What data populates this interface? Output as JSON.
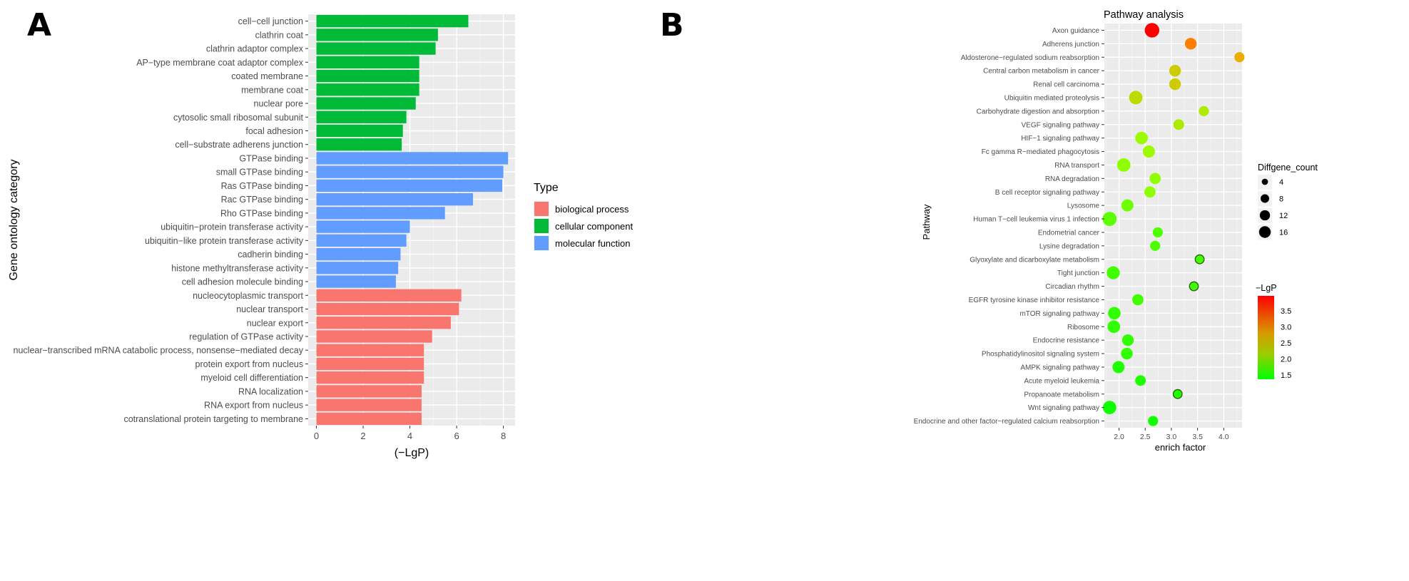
{
  "panels": {
    "a_label": "A",
    "b_label": "B"
  },
  "chart_data": [
    {
      "type": "bar",
      "orientation": "horizontal",
      "title": "",
      "xlabel": "(−LgP)",
      "ylabel": "Gene ontology category",
      "xlim": [
        0,
        8.5
      ],
      "xticks": [
        0,
        2,
        4,
        6,
        8
      ],
      "grid": true,
      "legend": {
        "title": "Type",
        "placement": "right",
        "entries": [
          {
            "label": "biological process",
            "color": "#F8766D"
          },
          {
            "label": "cellular component",
            "color": "#00BA38"
          },
          {
            "label": "molecular function",
            "color": "#619CFF"
          }
        ]
      },
      "categories": [
        "cell−cell junction",
        "clathrin coat",
        "clathrin adaptor complex",
        "AP−type membrane coat adaptor complex",
        "coated membrane",
        "membrane coat",
        "nuclear pore",
        "cytosolic small ribosomal subunit",
        "focal adhesion",
        "cell−substrate adherens junction",
        "GTPase binding",
        "small GTPase binding",
        "Ras GTPase binding",
        "Rac GTPase binding",
        "Rho GTPase binding",
        "ubiquitin−protein transferase activity",
        "ubiquitin−like protein transferase activity",
        "cadherin binding",
        "histone methyltransferase activity",
        "cell adhesion molecule binding",
        "nucleocytoplasmic transport",
        "nuclear transport",
        "nuclear export",
        "regulation of GTPase activity",
        "nuclear−transcribed mRNA catabolic process, nonsense−mediated decay",
        "protein export from nucleus",
        "myeloid cell differentiation",
        "RNA localization",
        "RNA export from nucleus",
        "cotranslational protein targeting to membrane"
      ],
      "values": [
        6.5,
        5.2,
        5.1,
        4.4,
        4.4,
        4.4,
        4.25,
        3.85,
        3.7,
        3.65,
        8.2,
        8.0,
        7.95,
        6.7,
        5.5,
        4.0,
        3.85,
        3.6,
        3.5,
        3.4,
        6.2,
        6.1,
        5.75,
        4.95,
        4.6,
        4.6,
        4.6,
        4.5,
        4.5,
        4.5
      ],
      "types": [
        "cellular component",
        "cellular component",
        "cellular component",
        "cellular component",
        "cellular component",
        "cellular component",
        "cellular component",
        "cellular component",
        "cellular component",
        "cellular component",
        "molecular function",
        "molecular function",
        "molecular function",
        "molecular function",
        "molecular function",
        "molecular function",
        "molecular function",
        "molecular function",
        "molecular function",
        "molecular function",
        "biological process",
        "biological process",
        "biological process",
        "biological process",
        "biological process",
        "biological process",
        "biological process",
        "biological process",
        "biological process",
        "biological process"
      ]
    },
    {
      "type": "scatter",
      "title": "Pathway analysis",
      "xlabel": "enrich factor",
      "ylabel": "Pathway",
      "xlim": [
        1.72,
        4.35
      ],
      "xticks": [
        "2.0",
        "2.5",
        "3.0",
        "3.5",
        "4.0"
      ],
      "grid": true,
      "size_legend": {
        "title": "Diffgene_count",
        "placement": "right",
        "values": [
          4,
          8,
          12,
          16
        ]
      },
      "color_legend": {
        "title": "−LgP",
        "placement": "right",
        "ticks": [
          "3.5",
          "3.0",
          "2.5",
          "2.0",
          "1.5"
        ],
        "range": [
          1.3,
          3.9
        ],
        "low_color": "#00FF00",
        "high_color": "#FF0000"
      },
      "points": [
        {
          "pathway": "Axon guidance",
          "enrich_factor": 2.63,
          "count": 16,
          "lgp": 3.9
        },
        {
          "pathway": "Adherens junction",
          "enrich_factor": 3.37,
          "count": 9,
          "lgp": 3.1
        },
        {
          "pathway": "Aldosterone−regulated sodium reabsorption",
          "enrich_factor": 4.3,
          "count": 6,
          "lgp": 2.8
        },
        {
          "pathway": "Central carbon metabolism in cancer",
          "enrich_factor": 3.07,
          "count": 9,
          "lgp": 2.6
        },
        {
          "pathway": "Renal cell carcinoma",
          "enrich_factor": 3.07,
          "count": 9,
          "lgp": 2.6
        },
        {
          "pathway": "Ubiquitin mediated proteolysis",
          "enrich_factor": 2.32,
          "count": 13,
          "lgp": 2.5
        },
        {
          "pathway": "Carbohydrate digestion and absorption",
          "enrich_factor": 3.62,
          "count": 6,
          "lgp": 2.4
        },
        {
          "pathway": "VEGF signaling pathway",
          "enrich_factor": 3.14,
          "count": 7,
          "lgp": 2.4
        },
        {
          "pathway": "HIF−1 signaling pathway",
          "enrich_factor": 2.43,
          "count": 11,
          "lgp": 2.3
        },
        {
          "pathway": "Fc gamma R−mediated phagocytosis",
          "enrich_factor": 2.57,
          "count": 10,
          "lgp": 2.3
        },
        {
          "pathway": "RNA transport",
          "enrich_factor": 2.09,
          "count": 13,
          "lgp": 2.2
        },
        {
          "pathway": "RNA degradation",
          "enrich_factor": 2.69,
          "count": 8,
          "lgp": 2.2
        },
        {
          "pathway": "B cell receptor signaling pathway",
          "enrich_factor": 2.59,
          "count": 8,
          "lgp": 2.2
        },
        {
          "pathway": "Lysosome",
          "enrich_factor": 2.16,
          "count": 10,
          "lgp": 2.0
        },
        {
          "pathway": "Human T−cell leukemia virus 1 infection",
          "enrich_factor": 1.82,
          "count": 15,
          "lgp": 1.9
        },
        {
          "pathway": "Endometrial cancer",
          "enrich_factor": 2.74,
          "count": 6,
          "lgp": 1.8
        },
        {
          "pathway": "Lysine degradation",
          "enrich_factor": 2.69,
          "count": 6,
          "lgp": 1.8
        },
        {
          "pathway": "Glyoxylate and dicarboxylate metabolism",
          "enrich_factor": 3.54,
          "count": 4,
          "lgp": 1.7
        },
        {
          "pathway": "Tight junction",
          "enrich_factor": 1.89,
          "count": 12,
          "lgp": 1.7
        },
        {
          "pathway": "Circadian rhythm",
          "enrich_factor": 3.43,
          "count": 4,
          "lgp": 1.7
        },
        {
          "pathway": "EGFR tyrosine kinase inhibitor resistance",
          "enrich_factor": 2.36,
          "count": 8,
          "lgp": 1.7
        },
        {
          "pathway": "mTOR signaling pathway",
          "enrich_factor": 1.91,
          "count": 11,
          "lgp": 1.6
        },
        {
          "pathway": "Ribosome",
          "enrich_factor": 1.9,
          "count": 11,
          "lgp": 1.6
        },
        {
          "pathway": "Endocrine resistance",
          "enrich_factor": 2.17,
          "count": 9,
          "lgp": 1.6
        },
        {
          "pathway": "Phosphatidylinositol signaling system",
          "enrich_factor": 2.15,
          "count": 9,
          "lgp": 1.6
        },
        {
          "pathway": "AMPK signaling pathway",
          "enrich_factor": 1.99,
          "count": 10,
          "lgp": 1.5
        },
        {
          "pathway": "Acute myeloid leukemia",
          "enrich_factor": 2.41,
          "count": 7,
          "lgp": 1.5
        },
        {
          "pathway": "Propanoate metabolism",
          "enrich_factor": 3.12,
          "count": 4,
          "lgp": 1.5
        },
        {
          "pathway": "Wnt signaling pathway",
          "enrich_factor": 1.82,
          "count": 13,
          "lgp": 1.4
        },
        {
          "pathway": "Endocrine and other factor−regulated calcium reabsorption",
          "enrich_factor": 2.65,
          "count": 6,
          "lgp": 1.4
        }
      ]
    }
  ]
}
